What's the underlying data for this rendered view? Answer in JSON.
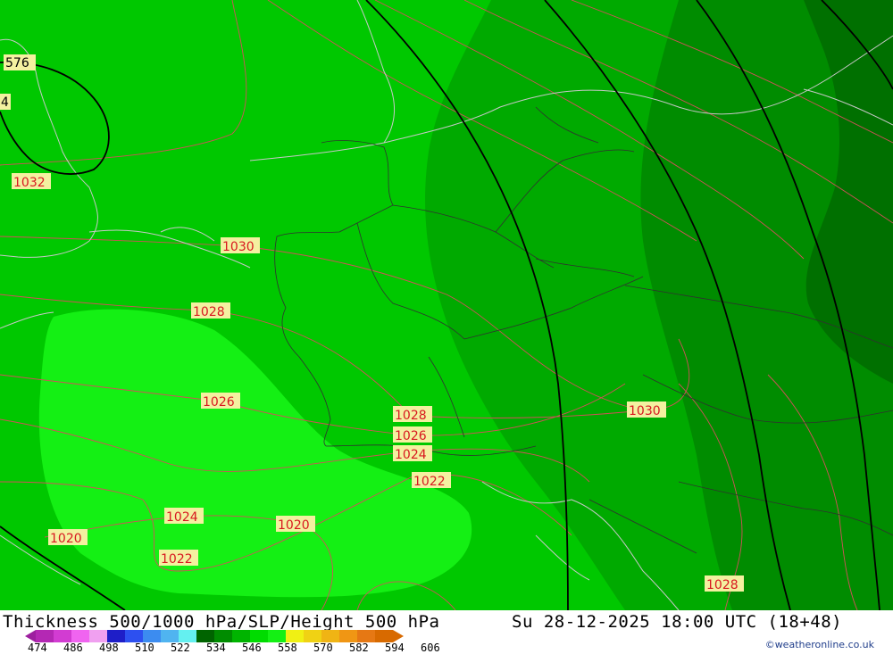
{
  "map": {
    "colors": {
      "light": "#14f014",
      "base": "#00c800",
      "mid": "#00aa00",
      "dark": "#008c00",
      "darker": "#007000",
      "isobar": "#d2505a",
      "border": "#303030",
      "coast": "#c8c8c8",
      "height": "#000000"
    },
    "height_labels": [
      "576",
      "4"
    ],
    "isobar_labels": [
      "1032",
      "1030",
      "1028",
      "1026",
      "1028",
      "1026",
      "1024",
      "1022",
      "1024",
      "1020",
      "1020",
      "1022",
      "1030",
      "1028"
    ]
  },
  "footer": {
    "title": "Thickness 500/1000 hPa/SLP/Height 500 hPa",
    "datetime": "Su 28-12-2025 18:00 UTC (18+48)",
    "credit": "©weatheronline.co.uk",
    "legend": {
      "ticks": [
        "474",
        "486",
        "498",
        "510",
        "522",
        "534",
        "546",
        "558",
        "570",
        "582",
        "594",
        "606"
      ],
      "colors": [
        "#b428b4",
        "#d23cd2",
        "#f064f0",
        "#f0a0f0",
        "#1e1ec8",
        "#2d50f0",
        "#3c8cf0",
        "#50b4f0",
        "#64f0f0",
        "#006400",
        "#008c00",
        "#00b400",
        "#00dc00",
        "#14f014",
        "#f0f014",
        "#f0d214",
        "#f0b414",
        "#f09614",
        "#e67814",
        "#d86a00"
      ]
    }
  }
}
